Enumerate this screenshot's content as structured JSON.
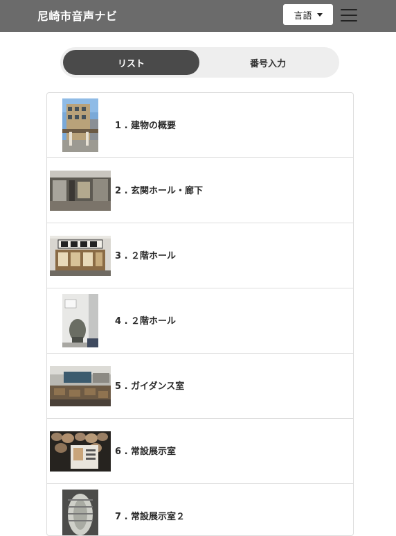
{
  "header": {
    "title": "尼崎市音声ナビ",
    "language_label": "言語"
  },
  "tabs": {
    "list": "リスト",
    "number": "番号入力"
  },
  "items": [
    {
      "label": "1 . 建物の概要",
      "thumb": "building-exterior-photo"
    },
    {
      "label": "2 . 玄関ホール・廊下",
      "thumb": "entrance-hall-photo"
    },
    {
      "label": "3 . ２階ホール",
      "thumb": "hospital-sign-photo"
    },
    {
      "label": "4 . ２階ホール",
      "thumb": "display-case-photo"
    },
    {
      "label": "5 . ガイダンス室",
      "thumb": "guidance-room-photo"
    },
    {
      "label": "6 . 常設展示室",
      "thumb": "pottery-exhibit-photo"
    },
    {
      "label": "7 . 常設展示室２",
      "thumb": "exhibit-object-photo"
    }
  ]
}
